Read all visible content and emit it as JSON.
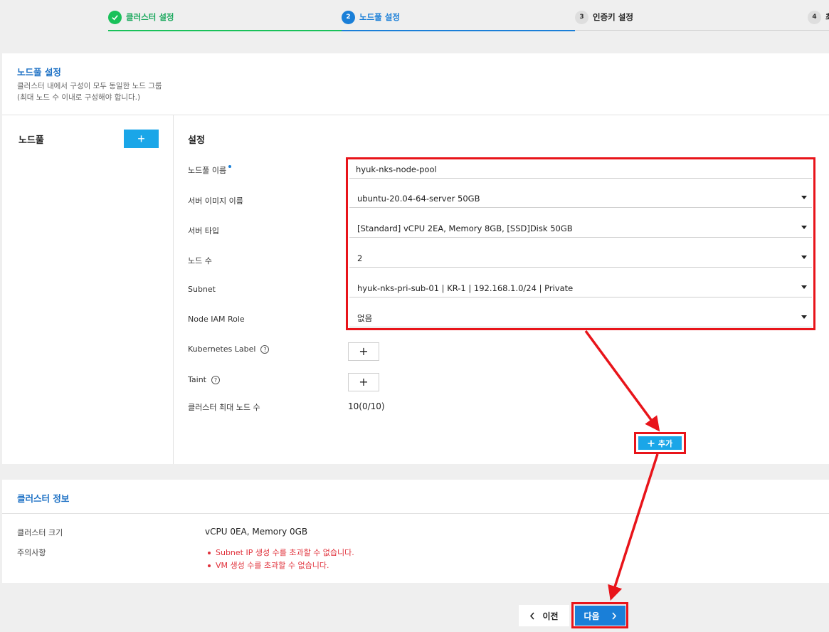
{
  "stepper": {
    "steps": [
      {
        "num": "",
        "label": "클러스터 설정",
        "state": "done"
      },
      {
        "num": "2",
        "label": "노드풀 설정",
        "state": "active"
      },
      {
        "num": "3",
        "label": "인증키 설정",
        "state": "pending"
      },
      {
        "num": "4",
        "label": "최",
        "state": "pending"
      }
    ]
  },
  "nodepool_section": {
    "title": "노드풀 설정",
    "desc_line1": "클러스터 내에서 구성이 모두 동일한 노드 그룹",
    "desc_line2": "(최대 노드 수 이내로 구성해야 합니다.)",
    "list_label": "노드풀",
    "add_pool_label": "+"
  },
  "settings": {
    "title": "설정",
    "fields": {
      "name": {
        "label": "노드풀 이름",
        "value": "hyuk-nks-node-pool"
      },
      "image": {
        "label": "서버 이미지 이름",
        "value": "ubuntu-20.04-64-server 50GB"
      },
      "type": {
        "label": "서버 타입",
        "value": "[Standard] vCPU 2EA, Memory 8GB, [SSD]Disk 50GB"
      },
      "count": {
        "label": "노드 수",
        "value": "2"
      },
      "subnet": {
        "label": "Subnet",
        "value": "hyuk-nks-pri-sub-01 | KR-1 | 192.168.1.0/24 | Private"
      },
      "iam": {
        "label": "Node IAM Role",
        "value": "없음"
      },
      "k8s_label": {
        "label": "Kubernetes Label",
        "button": "+"
      },
      "taint": {
        "label": "Taint",
        "button": "+"
      },
      "max_nodes": {
        "label": "클러스터 최대 노드 수",
        "value": "10(0/10)"
      }
    },
    "add_button": "추가"
  },
  "cluster_info": {
    "title": "클러스터 정보",
    "size_label": "클러스터 크기",
    "size_value": "vCPU 0EA, Memory 0GB",
    "notice_label": "주의사항",
    "warnings": [
      "Subnet IP 생성 수를 초과할 수 없습니다.",
      "VM 생성 수를 초과할 수 없습니다."
    ]
  },
  "footer": {
    "prev_label": "이전",
    "next_label": "다음"
  },
  "colors": {
    "accent": "#1a7fd8",
    "done": "#19c15a",
    "button": "#1aa6e8",
    "highlight": "#e8141a",
    "warning": "#e0303a"
  },
  "icons": {
    "check": "check-icon",
    "help": "help-icon",
    "caret": "caret-down-icon",
    "chevron_left": "chevron-left-icon",
    "chevron_right": "chevron-right-icon"
  }
}
